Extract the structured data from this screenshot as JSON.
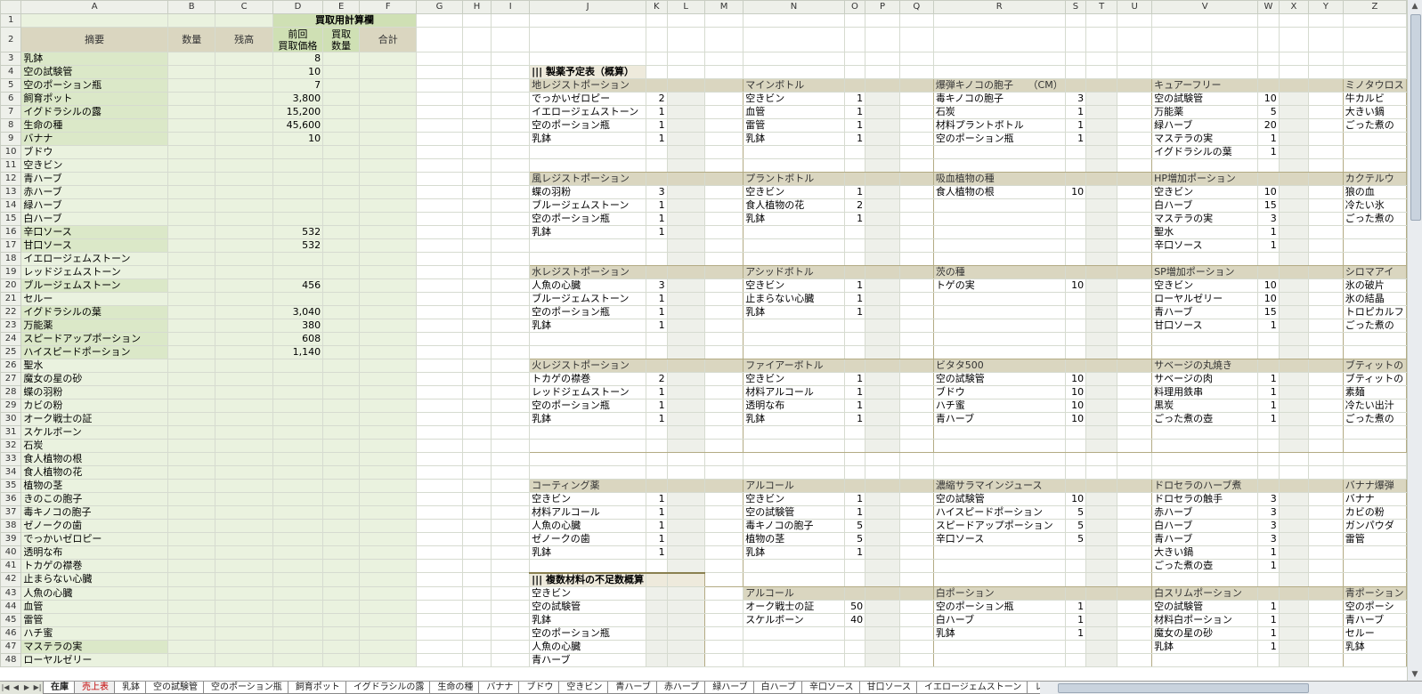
{
  "columns": [
    {
      "letter": "A",
      "w": 168
    },
    {
      "letter": "B",
      "w": 58
    },
    {
      "letter": "C",
      "w": 70
    },
    {
      "letter": "D",
      "w": 58
    },
    {
      "letter": "E",
      "w": 44
    },
    {
      "letter": "F",
      "w": 70
    },
    {
      "letter": "G",
      "w": 56
    },
    {
      "letter": "H",
      "w": 35
    },
    {
      "letter": "I",
      "w": 47
    },
    {
      "letter": "J",
      "w": 106
    },
    {
      "letter": "K",
      "w": 25
    },
    {
      "letter": "L",
      "w": 46
    },
    {
      "letter": "M",
      "w": 47
    },
    {
      "letter": "N",
      "w": 116
    },
    {
      "letter": "O",
      "w": 24
    },
    {
      "letter": "P",
      "w": 42
    },
    {
      "letter": "Q",
      "w": 41
    },
    {
      "letter": "R",
      "w": 121
    },
    {
      "letter": "S",
      "w": 24
    },
    {
      "letter": "T",
      "w": 38
    },
    {
      "letter": "U",
      "w": 42
    },
    {
      "letter": "V",
      "w": 121
    },
    {
      "letter": "W",
      "w": 24
    },
    {
      "letter": "X",
      "w": 36
    },
    {
      "letter": "Y",
      "w": 42
    },
    {
      "letter": "Z",
      "w": 60
    }
  ],
  "header": {
    "calc_title": "買取用計算欄",
    "summary": "摘要",
    "qty": "数量",
    "balance": "残高",
    "prev_price": "前回\n買取価格",
    "buy_qty": "買取\n数量",
    "total": "合計"
  },
  "items": [
    {
      "name": "乳鉢",
      "price": "8",
      "green": true
    },
    {
      "name": "空の試験管",
      "price": "10",
      "green": true
    },
    {
      "name": "空のポーション瓶",
      "price": "7",
      "green": true
    },
    {
      "name": "飼育ポット",
      "price": "3,800",
      "green": true
    },
    {
      "name": "イグドラシルの露",
      "price": "15,200",
      "green": true
    },
    {
      "name": "生命の種",
      "price": "45,600",
      "green": true
    },
    {
      "name": "バナナ",
      "price": "10",
      "green": true
    },
    {
      "name": "ブドウ",
      "price": "",
      "green": false
    },
    {
      "name": "空きビン",
      "price": "",
      "green": false
    },
    {
      "name": "青ハーブ",
      "price": "",
      "green": false
    },
    {
      "name": "赤ハーブ",
      "price": "",
      "green": false
    },
    {
      "name": "緑ハーブ",
      "price": "",
      "green": false
    },
    {
      "name": "白ハーブ",
      "price": "",
      "green": false
    },
    {
      "name": "辛口ソース",
      "price": "532",
      "green": true
    },
    {
      "name": "甘口ソース",
      "price": "532",
      "green": true
    },
    {
      "name": "イエロージェムストーン",
      "price": "",
      "green": false
    },
    {
      "name": "レッドジェムストーン",
      "price": "",
      "green": false
    },
    {
      "name": "ブルージェムストーン",
      "price": "456",
      "green": true
    },
    {
      "name": "セルー",
      "price": "",
      "green": false
    },
    {
      "name": "イグドラシルの葉",
      "price": "3,040",
      "green": true
    },
    {
      "name": "万能薬",
      "price": "380",
      "green": true
    },
    {
      "name": "スピードアップポーション",
      "price": "608",
      "green": true
    },
    {
      "name": "ハイスピードポーション",
      "price": "1,140",
      "green": true
    },
    {
      "name": "聖水",
      "price": "",
      "green": false
    },
    {
      "name": "魔女の星の砂",
      "price": "",
      "green": false
    },
    {
      "name": "蝶の羽粉",
      "price": "",
      "green": false
    },
    {
      "name": "カビの粉",
      "price": "",
      "green": false
    },
    {
      "name": "オーク戦士の証",
      "price": "",
      "green": false
    },
    {
      "name": "スケルボーン",
      "price": "",
      "green": false
    },
    {
      "name": "石炭",
      "price": "",
      "green": false
    },
    {
      "name": "食人植物の根",
      "price": "",
      "green": false
    },
    {
      "name": "食人植物の花",
      "price": "",
      "green": false
    },
    {
      "name": "植物の茎",
      "price": "",
      "green": false
    },
    {
      "name": "きのこの胞子",
      "price": "",
      "green": false
    },
    {
      "name": "毒キノコの胞子",
      "price": "",
      "green": false
    },
    {
      "name": "ゼノークの歯",
      "price": "",
      "green": false
    },
    {
      "name": "でっかいゼロピー",
      "price": "",
      "green": false
    },
    {
      "name": "透明な布",
      "price": "",
      "green": false
    },
    {
      "name": "トカゲの襟巻",
      "price": "",
      "green": false
    },
    {
      "name": "止まらない心臓",
      "price": "",
      "green": false
    },
    {
      "name": "人魚の心臓",
      "price": "",
      "green": false
    },
    {
      "name": "血管",
      "price": "",
      "green": false
    },
    {
      "name": "雷管",
      "price": "",
      "green": false
    },
    {
      "name": "ハチ蜜",
      "price": "",
      "green": false
    },
    {
      "name": "マステラの実",
      "price": "",
      "green": true
    },
    {
      "name": "ローヤルゼリー",
      "price": "",
      "green": false
    }
  ],
  "plan_title": "製薬予定表（概算）",
  "shortage_title": "複数材料の不足数概算",
  "shortage_items": [
    "空きビン",
    "空の試験管",
    "乳鉢",
    "空のポーション瓶",
    "人魚の心臓",
    "青ハーブ"
  ],
  "recipe_blocks": [
    [
      {
        "title": "地レジストポーション",
        "rows": [
          [
            "でっかいゼロピー",
            "2"
          ],
          [
            "イエロージェムストーン",
            "1"
          ],
          [
            "空のポーション瓶",
            "1"
          ],
          [
            "乳鉢",
            "1"
          ]
        ]
      },
      {
        "title": "マインボトル",
        "rows": [
          [
            "空きビン",
            "1"
          ],
          [
            "血管",
            "1"
          ],
          [
            "雷管",
            "1"
          ],
          [
            "乳鉢",
            "1"
          ]
        ]
      },
      {
        "title": "爆弾キノコの胞子　　（CM）",
        "rows": [
          [
            "毒キノコの胞子",
            "3"
          ],
          [
            "石炭",
            "1"
          ],
          [
            "材料プラントボトル",
            "1"
          ],
          [
            "空のポーション瓶",
            "1"
          ]
        ]
      },
      {
        "title": "キュアーフリー",
        "rows": [
          [
            "空の試験管",
            "10"
          ],
          [
            "万能薬",
            "5"
          ],
          [
            "緑ハーブ",
            "20"
          ],
          [
            "マステラの実",
            "1"
          ],
          [
            "イグドラシルの葉",
            "1"
          ]
        ]
      },
      {
        "title": "ミノタウロス",
        "rows": [
          [
            "牛カルビ",
            ""
          ],
          [
            "大きい鍋",
            ""
          ],
          [
            "ごった煮の",
            ""
          ]
        ]
      }
    ],
    [
      {
        "title": "風レジストポーション",
        "rows": [
          [
            "蝶の羽粉",
            "3"
          ],
          [
            "ブルージェムストーン",
            "1"
          ],
          [
            "空のポーション瓶",
            "1"
          ],
          [
            "乳鉢",
            "1"
          ]
        ]
      },
      {
        "title": "プラントボトル",
        "rows": [
          [
            "空きビン",
            "1"
          ],
          [
            "食人植物の花",
            "2"
          ],
          [
            "乳鉢",
            "1"
          ]
        ]
      },
      {
        "title": "吸血植物の種",
        "rows": [
          [
            "食人植物の根",
            "10"
          ]
        ]
      },
      {
        "title": "HP増加ポーション",
        "rows": [
          [
            "空きビン",
            "10"
          ],
          [
            "白ハーブ",
            "15"
          ],
          [
            "マステラの実",
            "3"
          ],
          [
            "聖水",
            "1"
          ],
          [
            "辛口ソース",
            "1"
          ]
        ]
      },
      {
        "title": "カクテルウ",
        "rows": [
          [
            "狼の血",
            ""
          ],
          [
            "冷たい氷",
            ""
          ],
          [
            "ごった煮の",
            ""
          ]
        ]
      }
    ],
    [
      {
        "title": "水レジストポーション",
        "rows": [
          [
            "人魚の心臓",
            "3"
          ],
          [
            "ブルージェムストーン",
            "1"
          ],
          [
            "空のポーション瓶",
            "1"
          ],
          [
            "乳鉢",
            "1"
          ]
        ]
      },
      {
        "title": "アシッドボトル",
        "rows": [
          [
            "空きビン",
            "1"
          ],
          [
            "止まらない心臓",
            "1"
          ],
          [
            "乳鉢",
            "1"
          ]
        ]
      },
      {
        "title": "茨の種",
        "rows": [
          [
            "トゲの実",
            "10"
          ]
        ]
      },
      {
        "title": "SP増加ポーション",
        "rows": [
          [
            "空きビン",
            "10"
          ],
          [
            "ローヤルゼリー",
            "10"
          ],
          [
            "青ハーブ",
            "15"
          ],
          [
            "甘口ソース",
            "1"
          ]
        ]
      },
      {
        "title": "シロマアイ",
        "rows": [
          [
            "氷の破片",
            ""
          ],
          [
            "氷の結晶",
            ""
          ],
          [
            "トロピカルフ",
            ""
          ],
          [
            "ごった煮の",
            ""
          ]
        ]
      }
    ],
    [
      {
        "title": "火レジストポーション",
        "rows": [
          [
            "トカゲの襟巻",
            "2"
          ],
          [
            "レッドジェムストーン",
            "1"
          ],
          [
            "空のポーション瓶",
            "1"
          ],
          [
            "乳鉢",
            "1"
          ]
        ]
      },
      {
        "title": "ファイアーボトル",
        "rows": [
          [
            "空きビン",
            "1"
          ],
          [
            "材料アルコール",
            "1"
          ],
          [
            "透明な布",
            "1"
          ],
          [
            "乳鉢",
            "1"
          ]
        ]
      },
      {
        "title": "ビタタ500",
        "rows": [
          [
            "空の試験管",
            "10"
          ],
          [
            "ブドウ",
            "10"
          ],
          [
            "ハチ蜜",
            "10"
          ],
          [
            "青ハーブ",
            "10"
          ]
        ]
      },
      {
        "title": "サベージの丸焼き",
        "rows": [
          [
            "サベージの肉",
            "1"
          ],
          [
            "料理用鉄串",
            "1"
          ],
          [
            "黒炭",
            "1"
          ],
          [
            "ごった煮の壺",
            "1"
          ]
        ]
      },
      {
        "title": "ブティットの",
        "rows": [
          [
            "ブティットの",
            ""
          ],
          [
            "素麺",
            ""
          ],
          [
            "冷たい出汁",
            ""
          ],
          [
            "ごった煮の",
            ""
          ]
        ]
      }
    ],
    [
      {
        "title": "コーティング薬",
        "rows": [
          [
            "空きビン",
            "1"
          ],
          [
            "材料アルコール",
            "1"
          ],
          [
            "人魚の心臓",
            "1"
          ],
          [
            "ゼノークの歯",
            "1"
          ],
          [
            "乳鉢",
            "1"
          ]
        ]
      },
      {
        "title": "アルコール",
        "rows": [
          [
            "空きビン",
            "1"
          ],
          [
            "空の試験管",
            "1"
          ],
          [
            "毒キノコの胞子",
            "5"
          ],
          [
            "植物の茎",
            "5"
          ],
          [
            "乳鉢",
            "1"
          ]
        ]
      },
      {
        "title": "濃縮サラマインジュース",
        "rows": [
          [
            "空の試験管",
            "10"
          ],
          [
            "ハイスピードポーション",
            "5"
          ],
          [
            "スピードアップポーション",
            "5"
          ],
          [
            "辛口ソース",
            "5"
          ]
        ]
      },
      {
        "title": "ドロセラのハーブ煮",
        "rows": [
          [
            "ドロセラの触手",
            "3"
          ],
          [
            "赤ハーブ",
            "3"
          ],
          [
            "白ハーブ",
            "3"
          ],
          [
            "青ハーブ",
            "3"
          ],
          [
            "大きい鍋",
            "1"
          ],
          [
            "ごった煮の壺",
            "1"
          ]
        ]
      },
      {
        "title": "バナナ爆弾",
        "rows": [
          [
            "バナナ",
            ""
          ],
          [
            "カビの粉",
            ""
          ],
          [
            "ガンパウダ",
            ""
          ],
          [
            "雷管",
            ""
          ]
        ]
      }
    ],
    [
      {
        "title": "",
        "rows": []
      },
      {
        "title": "アルコール",
        "rows": [
          [
            "オーク戦士の証",
            "50"
          ],
          [
            "スケルボーン",
            "40"
          ]
        ]
      },
      {
        "title": "白ポーション",
        "rows": [
          [
            "空のポーション瓶",
            "1"
          ],
          [
            "白ハーブ",
            "1"
          ],
          [
            "乳鉢",
            "1"
          ]
        ]
      },
      {
        "title": "白スリムポーション",
        "rows": [
          [
            "空の試験管",
            "1"
          ],
          [
            "材料白ポーション",
            "1"
          ],
          [
            "魔女の星の砂",
            "1"
          ],
          [
            "乳鉢",
            "1"
          ]
        ]
      },
      {
        "title": "青ポーション",
        "rows": [
          [
            "空のポーシ",
            ""
          ],
          [
            "青ハーブ",
            ""
          ],
          [
            "セルー",
            ""
          ],
          [
            "乳鉢",
            ""
          ]
        ]
      }
    ]
  ],
  "tabs": [
    {
      "label": "在庫",
      "active": true,
      "red": false
    },
    {
      "label": "売上表",
      "active": false,
      "red": true
    },
    {
      "label": "乳鉢",
      "active": false,
      "red": false
    },
    {
      "label": "空の試験管",
      "active": false,
      "red": false
    },
    {
      "label": "空のポーション瓶",
      "active": false,
      "red": false
    },
    {
      "label": "飼育ポット",
      "active": false,
      "red": false
    },
    {
      "label": "イグドラシルの露",
      "active": false,
      "red": false
    },
    {
      "label": "生命の種",
      "active": false,
      "red": false
    },
    {
      "label": "バナナ",
      "active": false,
      "red": false
    },
    {
      "label": "ブドウ",
      "active": false,
      "red": false
    },
    {
      "label": "空きビン",
      "active": false,
      "red": false
    },
    {
      "label": "青ハーブ",
      "active": false,
      "red": false
    },
    {
      "label": "赤ハーブ",
      "active": false,
      "red": false
    },
    {
      "label": "緑ハーブ",
      "active": false,
      "red": false
    },
    {
      "label": "白ハーブ",
      "active": false,
      "red": false
    },
    {
      "label": "辛口ソース",
      "active": false,
      "red": false
    },
    {
      "label": "甘口ソース",
      "active": false,
      "red": false
    },
    {
      "label": "イエロージェムストーン",
      "active": false,
      "red": false
    },
    {
      "label": "レッドジェムスト",
      "active": false,
      "red": false
    }
  ],
  "colors": {
    "green": "#dbe8c8",
    "light_green": "#eaf2df",
    "header_tan": "#dad6c0"
  }
}
